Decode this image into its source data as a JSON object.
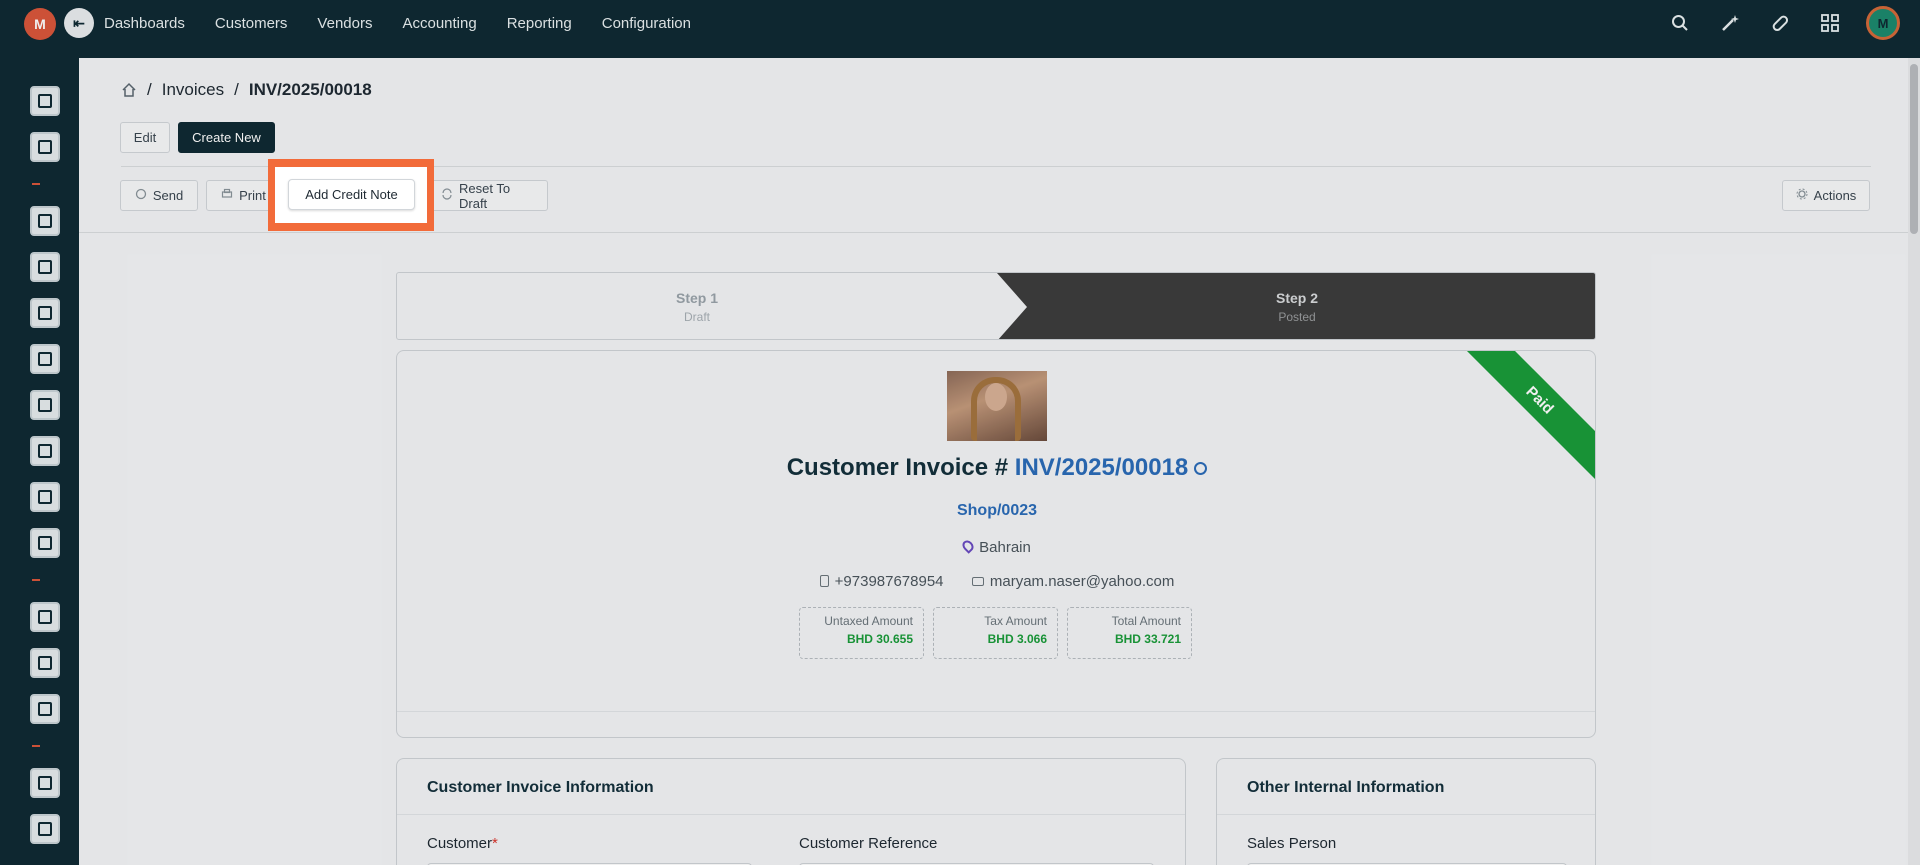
{
  "topbar": {
    "logo_text": "M",
    "collapse_glyph": "⇤",
    "nav": [
      "Dashboards",
      "Customers",
      "Vendors",
      "Accounting",
      "Reporting",
      "Configuration"
    ],
    "avatar_text": "M",
    "icons": [
      "search-icon",
      "magic-wand-icon",
      "pill-icon",
      "apps-grid-icon"
    ]
  },
  "breadcrumb": {
    "parent": "Invoices",
    "separator": "/",
    "current": "INV/2025/00018"
  },
  "toolbar": {
    "edit": "Edit",
    "create_new": "Create New",
    "send": "Send",
    "print": "Print",
    "add_credit_note": "Add Credit Note",
    "reset_to_draft": "Reset To Draft",
    "actions": "Actions"
  },
  "stepper": {
    "step1_title": "Step 1",
    "step1_sub": "Draft",
    "step2_title": "Step 2",
    "step2_sub": "Posted"
  },
  "invoice": {
    "ribbon": "Paid",
    "title_prefix": "Customer Invoice #",
    "number": "INV/2025/00018",
    "shop": "Shop/0023",
    "location": "Bahrain",
    "phone": "+973987678954",
    "email": "maryam.naser@yahoo.com",
    "amounts": [
      {
        "label": "Untaxed Amount",
        "value": "BHD 30.655"
      },
      {
        "label": "Tax Amount",
        "value": "BHD 3.066"
      },
      {
        "label": "Total Amount",
        "value": "BHD 33.721"
      }
    ]
  },
  "panels": {
    "info_title": "Customer Invoice Information",
    "customer_label": "Customer",
    "customer_ref_label": "Customer Reference",
    "other_title": "Other Internal Information",
    "sales_person_label": "Sales Person"
  },
  "colors": {
    "topbar": "#0f2a33",
    "accent": "#f26b3a",
    "paid": "#1a9c3a",
    "link": "#2b6cb8"
  }
}
